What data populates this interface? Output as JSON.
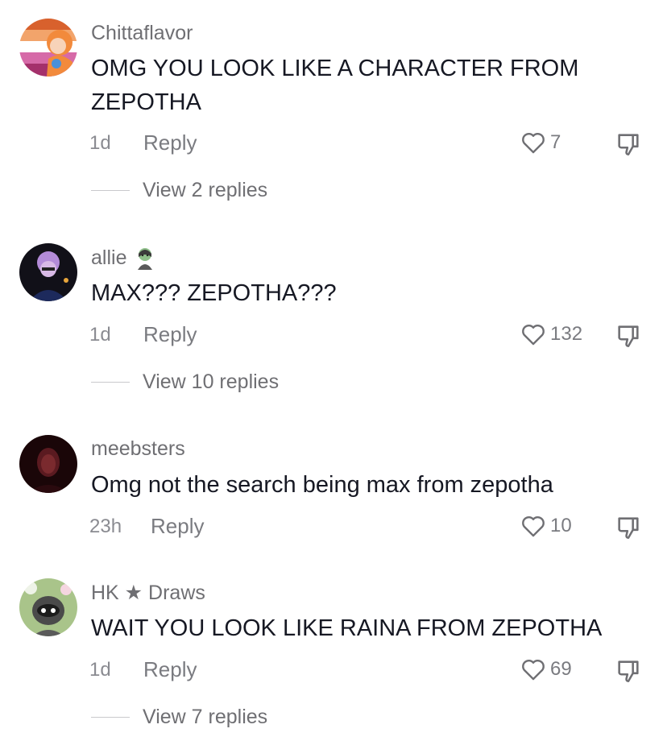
{
  "comments": [
    {
      "username": "Chittaflavor",
      "text": "OMG YOU LOOK LIKE A CHARACTER FROM ZEPOTHA",
      "time": "1d",
      "reply_label": "Reply",
      "likes": "7",
      "view_replies": "View 2 replies"
    },
    {
      "username": "allie",
      "text": "MAX??? ZEPOTHA???",
      "time": "1d",
      "reply_label": "Reply",
      "likes": "132",
      "view_replies": "View 10 replies"
    },
    {
      "username": "meebsters",
      "text": "Omg not the search being max from zepotha",
      "time": "23h",
      "reply_label": "Reply",
      "likes": "10"
    },
    {
      "username": "HK ★ Draws",
      "text": "WAIT YOU LOOK LIKE RAINA FROM ZEPOTHA",
      "time": "1d",
      "reply_label": "Reply",
      "likes": "69",
      "view_replies": "View 7 replies"
    }
  ],
  "icons": {
    "like": "heart-outline-icon",
    "dislike": "thumbs-down-outline-icon",
    "username_badge": "zombie-emoji-icon"
  },
  "colors": {
    "text": "#161823",
    "muted": "#8a8b91",
    "background": "#ffffff"
  }
}
